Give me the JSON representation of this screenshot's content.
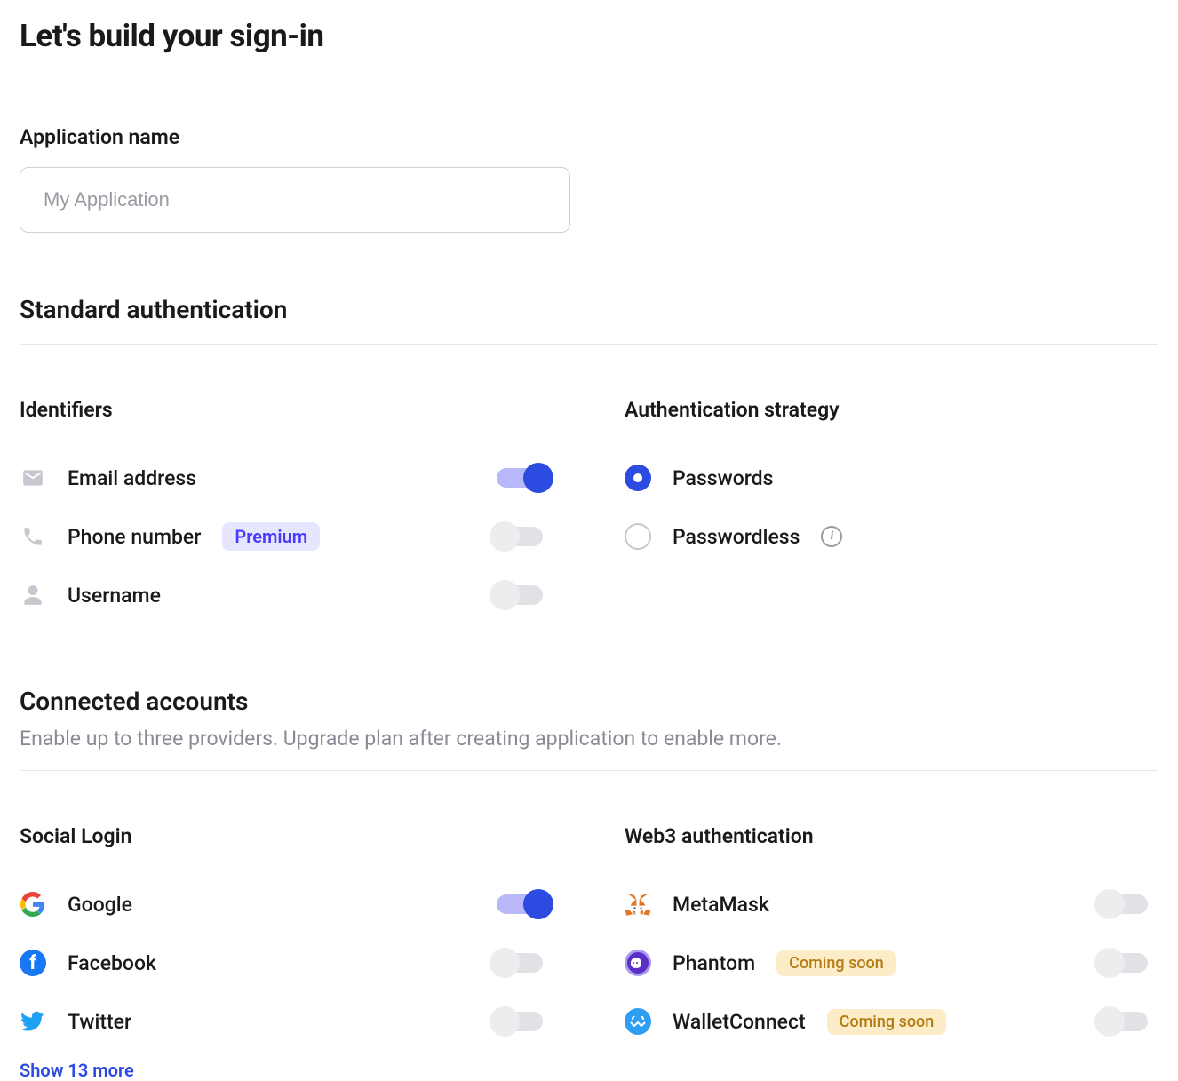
{
  "page_title": "Let's build your sign-in",
  "app_name": {
    "label": "Application name",
    "placeholder": "My Application",
    "value": ""
  },
  "standard_auth": {
    "heading": "Standard authentication",
    "identifiers": {
      "title": "Identifiers",
      "items": [
        {
          "icon": "mail",
          "label": "Email address",
          "enabled": true
        },
        {
          "icon": "phone",
          "label": "Phone number",
          "badge": "Premium",
          "enabled": false
        },
        {
          "icon": "user",
          "label": "Username",
          "enabled": false
        }
      ]
    },
    "strategy": {
      "title": "Authentication strategy",
      "items": [
        {
          "label": "Passwords",
          "selected": true
        },
        {
          "label": "Passwordless",
          "selected": false,
          "info": true
        }
      ]
    }
  },
  "connected": {
    "heading": "Connected accounts",
    "sub": "Enable up to three providers. Upgrade plan after creating application to enable more.",
    "social": {
      "title": "Social Login",
      "items": [
        {
          "icon": "google",
          "label": "Google",
          "enabled": true
        },
        {
          "icon": "facebook",
          "label": "Facebook",
          "enabled": false
        },
        {
          "icon": "twitter",
          "label": "Twitter",
          "enabled": false
        }
      ],
      "more_label": "Show 13 more"
    },
    "web3": {
      "title": "Web3 authentication",
      "items": [
        {
          "icon": "metamask",
          "label": "MetaMask",
          "enabled": false
        },
        {
          "icon": "phantom",
          "label": "Phantom",
          "badge": "Coming soon",
          "enabled": false
        },
        {
          "icon": "walletconnect",
          "label": "WalletConnect",
          "badge": "Coming soon",
          "enabled": false
        }
      ]
    }
  }
}
